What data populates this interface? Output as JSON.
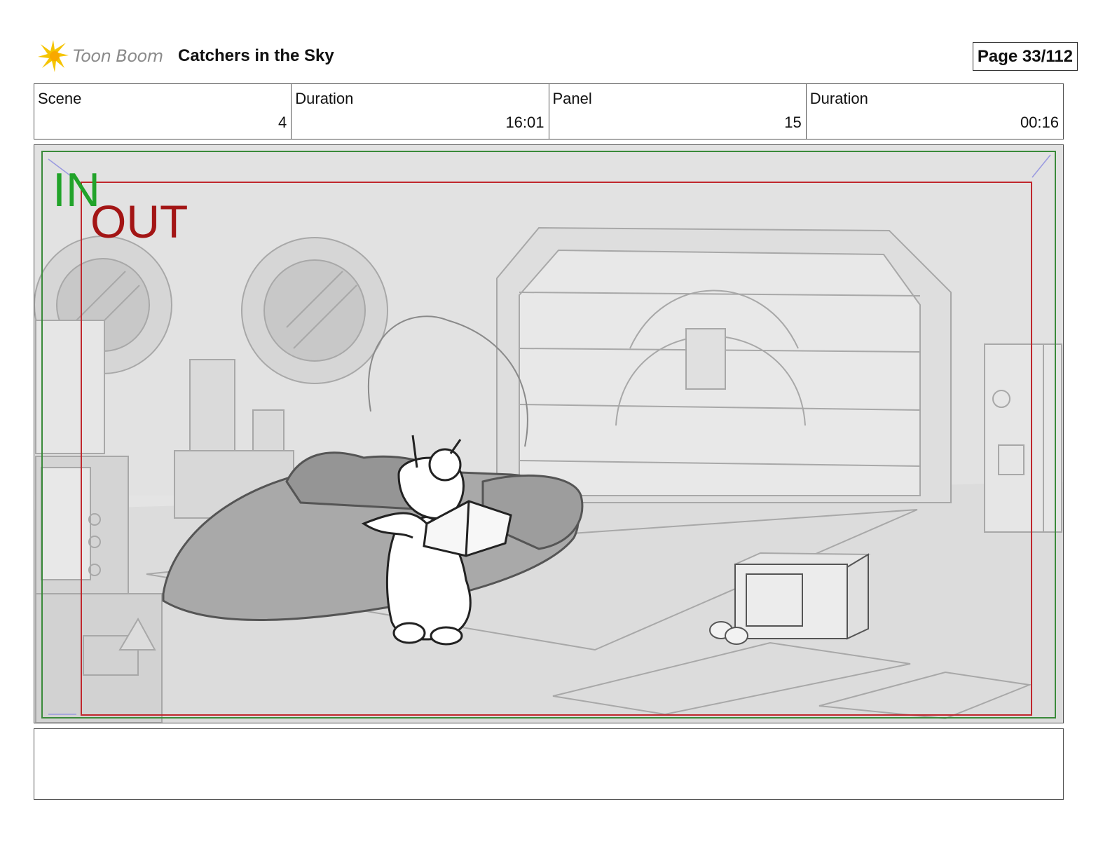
{
  "brand": {
    "logo_text": "Toon Boom"
  },
  "project_title": "Catchers in the Sky",
  "page": {
    "label": "Page  33/112"
  },
  "info": {
    "scene_label": "Scene",
    "scene_value": "4",
    "scene_duration_label": "Duration",
    "scene_duration_value": "16:01",
    "panel_label": "Panel",
    "panel_value": "15",
    "panel_duration_label": "Duration",
    "panel_duration_value": "00:16"
  },
  "frame_labels": {
    "in": "IN",
    "out": "OUT"
  },
  "colors": {
    "in_frame": "#3a8a3a",
    "out_frame": "#c0272d",
    "logo_star": "#f5c400"
  },
  "notes": ""
}
